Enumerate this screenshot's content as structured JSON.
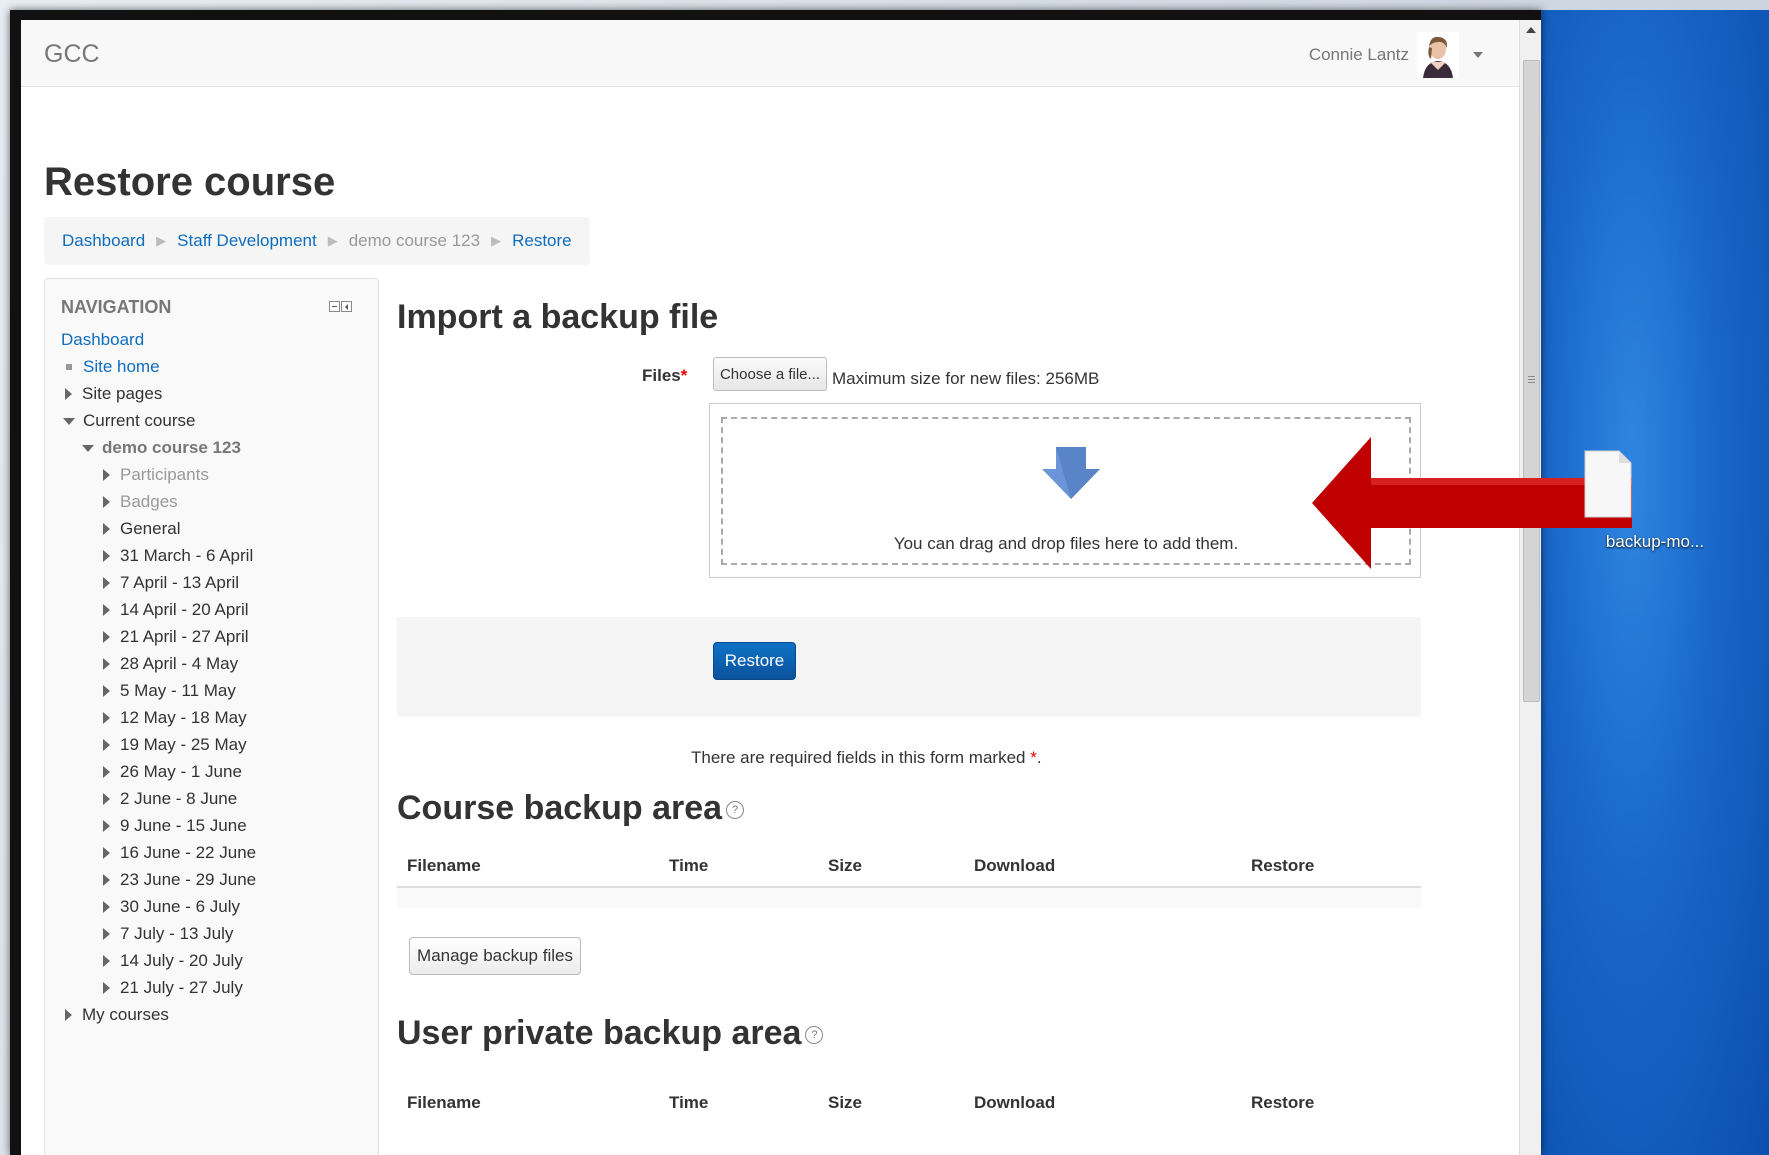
{
  "navbar": {
    "brand": "GCC",
    "user_name": "Connie Lantz"
  },
  "page": {
    "title": "Restore course"
  },
  "breadcrumb": [
    {
      "label": "Dashboard",
      "link": true
    },
    {
      "label": "Staff Development",
      "link": true
    },
    {
      "label": "demo course 123",
      "link": false
    },
    {
      "label": "Restore",
      "link": true
    }
  ],
  "navigation": {
    "title": "NAVIGATION",
    "items": [
      {
        "label": "Dashboard"
      },
      {
        "label": "Site home"
      },
      {
        "label": "Site pages"
      },
      {
        "label": "Current course"
      },
      {
        "label": "demo course 123"
      },
      {
        "label": "Participants"
      },
      {
        "label": "Badges"
      },
      {
        "label": "General"
      },
      {
        "label": "31 March - 6 April"
      },
      {
        "label": "7 April - 13 April"
      },
      {
        "label": "14 April - 20 April"
      },
      {
        "label": "21 April - 27 April"
      },
      {
        "label": "28 April - 4 May"
      },
      {
        "label": "5 May - 11 May"
      },
      {
        "label": "12 May - 18 May"
      },
      {
        "label": "19 May - 25 May"
      },
      {
        "label": "26 May - 1 June"
      },
      {
        "label": "2 June - 8 June"
      },
      {
        "label": "9 June - 15 June"
      },
      {
        "label": "16 June - 22 June"
      },
      {
        "label": "23 June - 29 June"
      },
      {
        "label": "30 June - 6 July"
      },
      {
        "label": "7 July - 13 July"
      },
      {
        "label": "14 July - 20 July"
      },
      {
        "label": "21 July - 27 July"
      },
      {
        "label": "My courses"
      }
    ]
  },
  "import": {
    "heading": "Import a backup file",
    "files_label": "Files",
    "required_marker": "*",
    "choose_button": "Choose a file...",
    "max_size": "Maximum size for new files: 256MB",
    "drop_text": "You can drag and drop files here to add them.",
    "restore_button": "Restore",
    "required_note": "There are required fields in this form marked",
    "required_note_end": "."
  },
  "course_backup": {
    "heading": "Course backup area",
    "help": "?",
    "columns": [
      "Filename",
      "Time",
      "Size",
      "Download",
      "Restore"
    ],
    "manage_button": "Manage backup files"
  },
  "user_backup": {
    "heading": "User private backup area",
    "help": "?",
    "columns": [
      "Filename",
      "Time",
      "Size",
      "Download",
      "Restore"
    ]
  },
  "desktop": {
    "file_label": "backup-mo..."
  },
  "colors": {
    "link": "#0f6cbf",
    "primary_button": "#0b5aa8",
    "annotation_arrow": "#c00000",
    "desktop": "#1866c8"
  }
}
